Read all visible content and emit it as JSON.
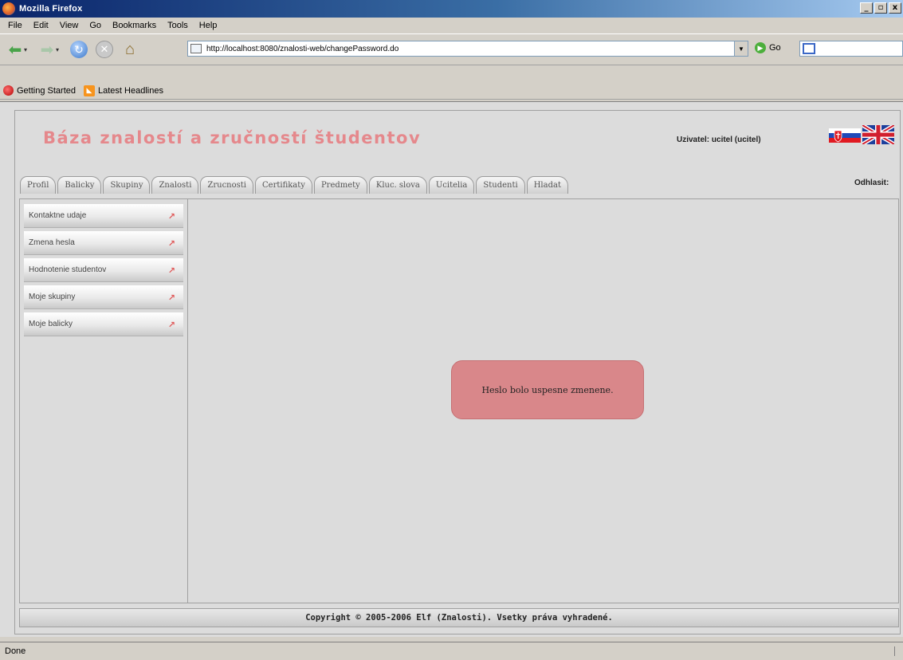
{
  "window": {
    "title": "Mozilla Firefox",
    "min": "_",
    "max": "▫",
    "close": "x"
  },
  "menu": [
    "File",
    "Edit",
    "View",
    "Go",
    "Bookmarks",
    "Tools",
    "Help"
  ],
  "nav": {
    "url": "http://localhost:8080/znalosti-web/changePassword.do",
    "go_label": "Go"
  },
  "bookmarks": [
    "Getting Started",
    "Latest Headlines"
  ],
  "site": {
    "title": "Báza znalostí a zručností študentov",
    "user_info": "Uzivatel: ucitel (ucitel)",
    "logout": "Odhlasit:"
  },
  "tabs": [
    "Profil",
    "Balicky",
    "Skupiny",
    "Znalosti",
    "Zrucnosti",
    "Certifikaty",
    "Predmety",
    "Kluc. slova",
    "Ucitelia",
    "Studenti",
    "Hladat"
  ],
  "sidebar": [
    "Kontaktne udaje",
    "Zmena hesla",
    "Hodnotenie studentov",
    "Moje skupiny",
    "Moje balicky"
  ],
  "message": "Heslo bolo uspesne zmenene.",
  "footer": "Copyright © 2005-2006 Elf (Znalosti). Vsetky práva vyhradené.",
  "status": "Done",
  "colors": {
    "accent": "#e5888c",
    "message_bg": "#d9878a",
    "chrome": "#d4d0c8"
  }
}
